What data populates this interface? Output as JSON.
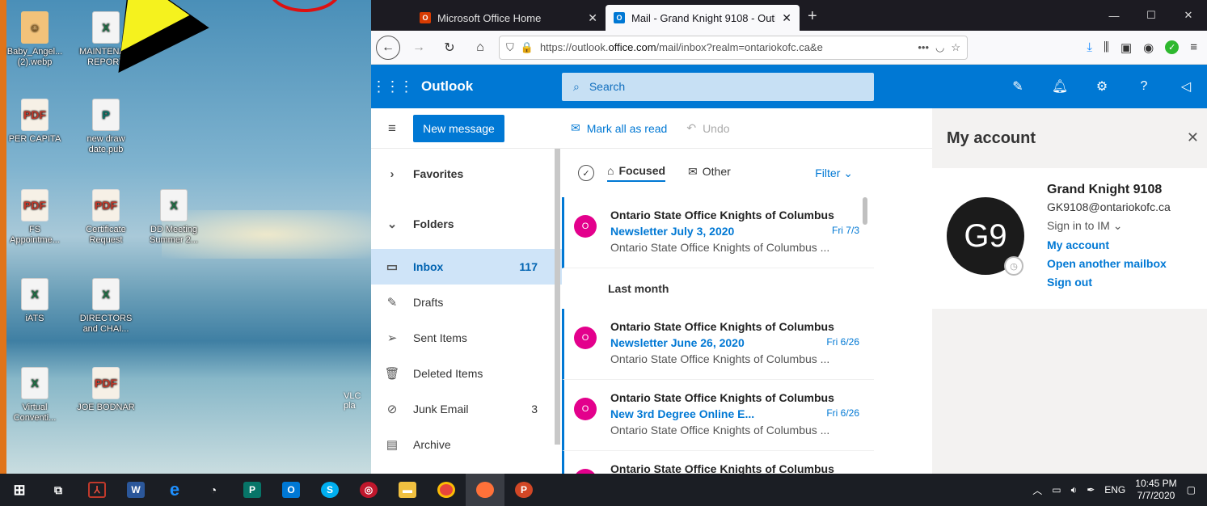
{
  "desktop": {
    "icons": [
      {
        "label": "Baby_Angel... (2).webp",
        "badge": "☺"
      },
      {
        "label": "MAINTENA... REPORT",
        "badge": "X"
      },
      {
        "label": "PER CAPITA",
        "badge": "PDF"
      },
      {
        "label": "new draw date.pub",
        "badge": "P"
      },
      {
        "label": "FS Appointme...",
        "badge": "PDF"
      },
      {
        "label": "Certificate Request",
        "badge": "PDF"
      },
      {
        "label": "DD Meeting Summer 2...",
        "badge": "X"
      },
      {
        "label": "iATS",
        "badge": "X"
      },
      {
        "label": "DIRECTORS and CHAI...",
        "badge": "X"
      },
      {
        "label": "Virtual Conventi...",
        "badge": "X"
      },
      {
        "label": "JOE BODNAR",
        "badge": "PDF"
      }
    ],
    "vlc_label": "VLC pla"
  },
  "browser": {
    "tabs": [
      {
        "title": "Microsoft Office Home",
        "fav": "O",
        "fav_color": "#d83b01"
      },
      {
        "title": "Mail - Grand Knight 9108 - Outl",
        "fav": "O",
        "fav_color": "#0078d4"
      }
    ],
    "new_tab": "+",
    "url_prefix": "https://outlook.",
    "url_domain": "office.com",
    "url_rest": "/mail/inbox?realm=ontariokofc.ca&e",
    "url_more": "•••"
  },
  "outlook": {
    "brand": "Outlook",
    "search_placeholder": "Search",
    "new_message": "New message",
    "mark_all_read": "Mark all as read",
    "undo": "Undo",
    "nav": {
      "favorites": "Favorites",
      "folders": "Folders",
      "items": [
        {
          "label": "Inbox",
          "count": "117",
          "icon": "▭"
        },
        {
          "label": "Drafts",
          "count": "",
          "icon": "✎"
        },
        {
          "label": "Sent Items",
          "count": "",
          "icon": "➢"
        },
        {
          "label": "Deleted Items",
          "count": "",
          "icon": "🗑"
        },
        {
          "label": "Junk Email",
          "count": "3",
          "icon": "⊘"
        },
        {
          "label": "Archive",
          "count": "",
          "icon": "▤"
        }
      ]
    },
    "pivots": {
      "focused": "Focused",
      "other": "Other",
      "filter": "Filter"
    },
    "group_last_month": "Last month",
    "messages": [
      {
        "avatar": "O",
        "from": "Ontario State Office Knights of Columbus",
        "subject": "Newsletter July 3, 2020",
        "date": "Fri 7/3",
        "preview": "Ontario State Office Knights of Columbus ..."
      },
      {
        "avatar": "O",
        "from": "Ontario State Office Knights of Columbus",
        "subject": "Newsletter June 26, 2020",
        "date": "Fri 6/26",
        "preview": "Ontario State Office Knights of Columbus ..."
      },
      {
        "avatar": "O",
        "from": "Ontario State Office Knights of Columbus",
        "subject": "New 3rd Degree  Online E...",
        "date": "Fri 6/26",
        "preview": "Ontario State Office Knights of Columbus ..."
      },
      {
        "avatar": "O",
        "from": "Ontario State Office Knights of Columbus",
        "subject": "",
        "date": "",
        "preview": ""
      }
    ],
    "account": {
      "title": "My account",
      "initials": "G9",
      "name": "Grand Knight 9108",
      "email": "GK9108@ontariokofc.ca",
      "sign_in_im": "Sign in to IM",
      "my_account": "My account",
      "open_mailbox": "Open another mailbox",
      "sign_out": "Sign out"
    }
  },
  "taskbar": {
    "lang": "ENG",
    "time": "10:45 PM",
    "date": "7/7/2020"
  },
  "colors": {
    "accent": "#0078d4",
    "avatar": "#e3008c"
  }
}
